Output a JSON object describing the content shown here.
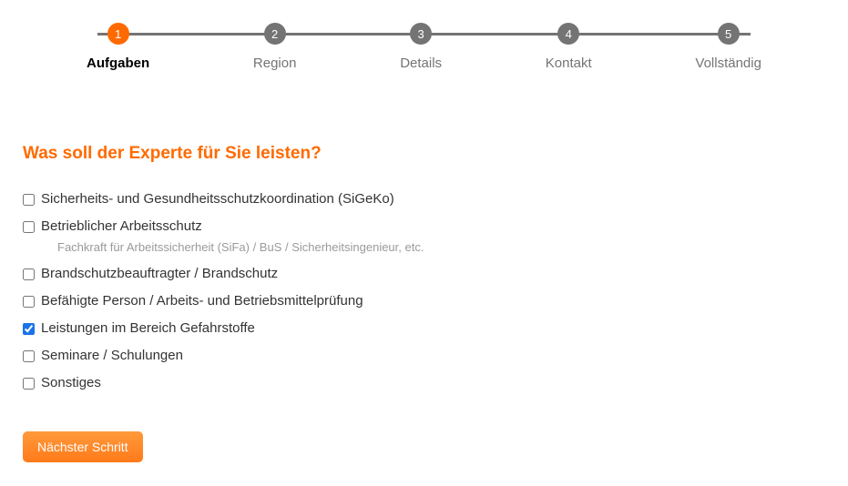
{
  "stepper": {
    "steps": [
      {
        "number": "1",
        "label": "Aufgaben",
        "active": true
      },
      {
        "number": "2",
        "label": "Region",
        "active": false
      },
      {
        "number": "3",
        "label": "Details",
        "active": false
      },
      {
        "number": "4",
        "label": "Kontakt",
        "active": false
      },
      {
        "number": "5",
        "label": "Vollständig",
        "active": false
      }
    ]
  },
  "question_title": "Was soll der Experte für Sie leisten?",
  "options": [
    {
      "label": "Sicherheits- und Gesundheitsschutzkoordination (SiGeKo)",
      "checked": false
    },
    {
      "label": "Betrieblicher Arbeitsschutz",
      "checked": false,
      "sublabel": "Fachkraft für Arbeitssicherheit (SiFa) / BuS / Sicherheitsingenieur, etc."
    },
    {
      "label": "Brandschutzbeauftragter / Brandschutz",
      "checked": false
    },
    {
      "label": "Befähigte Person / Arbeits- und Betriebsmittelprüfung",
      "checked": false
    },
    {
      "label": "Leistungen im Bereich Gefahrstoffe",
      "checked": true
    },
    {
      "label": "Seminare / Schulungen",
      "checked": false
    },
    {
      "label": "Sonstiges",
      "checked": false
    }
  ],
  "buttons": {
    "next": "Nächster Schritt"
  }
}
